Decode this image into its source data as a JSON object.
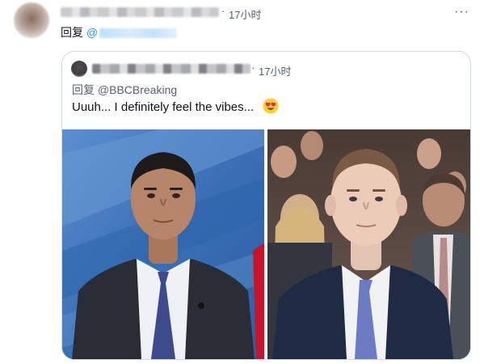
{
  "outer": {
    "timestamp": "17小时",
    "dot": "·",
    "reply_prefix": "回复",
    "handle_at": "@",
    "more": "···"
  },
  "quote": {
    "timestamp": "17小时",
    "dot": "·",
    "reply_text": "回复 @BBCBreaking",
    "body": "Uuuh... I definitely feel the vibes...",
    "emoji_icon": "heart-eyes-emoji"
  },
  "photos": [
    {
      "subject": "man-in-suit-blue-backdrop"
    },
    {
      "subject": "man-in-suit-hearing-room"
    }
  ],
  "colors": {
    "link": "#1d9bf0",
    "secondary_text": "#536471",
    "border": "#cfd9de"
  }
}
